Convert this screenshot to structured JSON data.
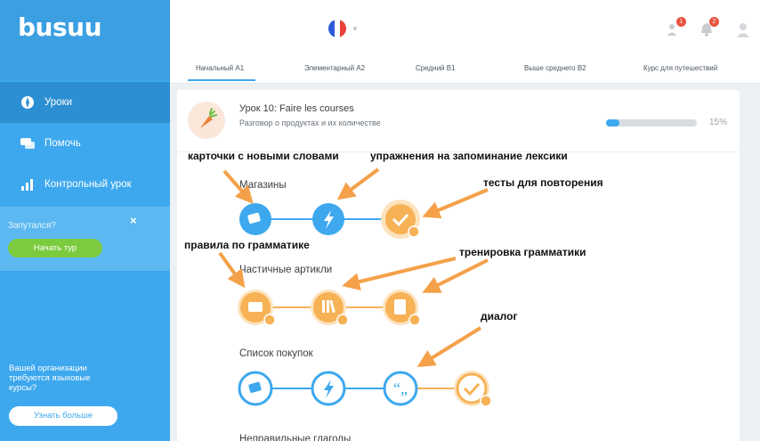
{
  "sidebar": {
    "logo": "busuu",
    "nav": [
      {
        "label": "Уроки",
        "icon": "lessons-icon"
      },
      {
        "label": "Помочь",
        "icon": "chat-icon"
      },
      {
        "label": "Контрольный урок",
        "icon": "bar-chart-icon"
      }
    ],
    "help_title": "Запутался?",
    "help_close": "×",
    "tour_button": "Начать тур",
    "org_text": "Вашей организации требуются языковые курсы?",
    "learn_more": "Узнать больше"
  },
  "header": {
    "notif_badge": "1",
    "bell_badge": "2"
  },
  "tabs": [
    "Начальный А1",
    "Элементарный А2",
    "Средний В1",
    "Выше среднего В2",
    "Курс для путешествий"
  ],
  "lesson": {
    "title": "Урок 10: Faire les courses",
    "subtitle": "Разговор о продуктах и их количестве",
    "progress": 15,
    "progress_label": "15%"
  },
  "groups": [
    "Магазины",
    "Частичные артикли",
    "Список покупок",
    "Неправильные глаголы"
  ],
  "annotations": {
    "flashcards": "карточки с новыми словами",
    "vocab_exercises": "упражнения на запоминание лексики",
    "review_tests": "тесты для повторения",
    "grammar_rules": "правила по грамматике",
    "grammar_practice": "тренировка грамматики",
    "dialog": "диалог"
  },
  "colors": {
    "blue": "#3da8ee",
    "orange": "#f7b256",
    "green": "#7ccb3f",
    "arrow": "#f4a14a"
  }
}
